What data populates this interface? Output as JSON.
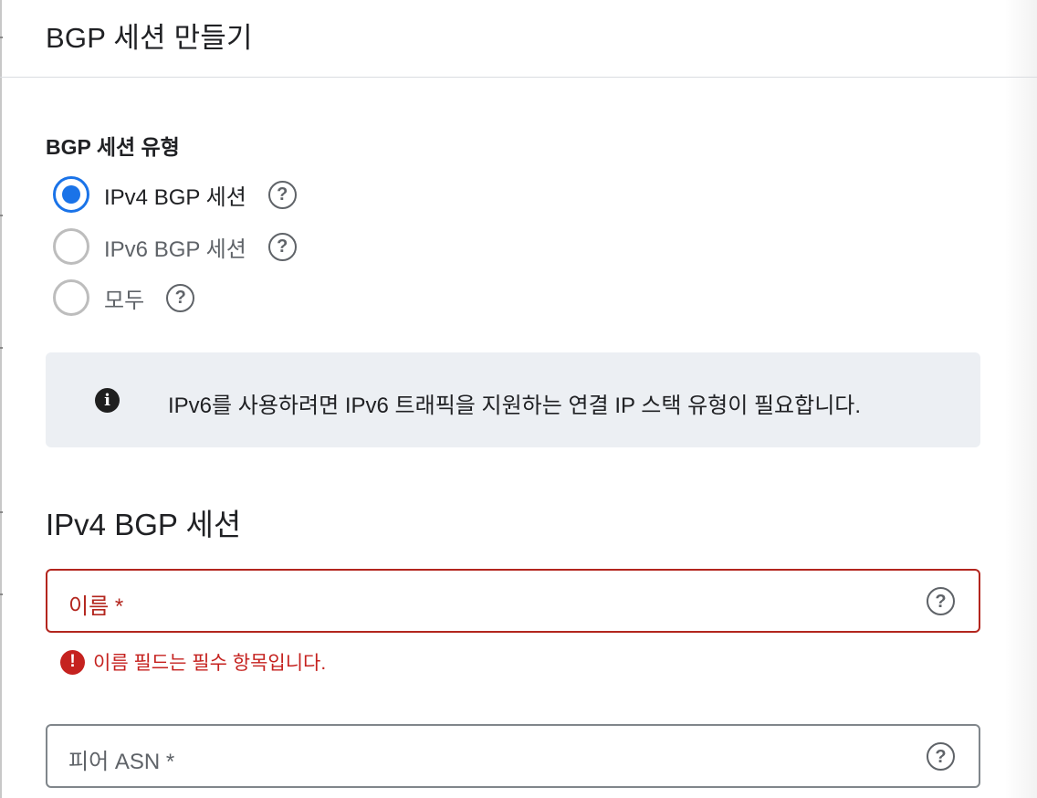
{
  "dialog": {
    "title": "BGP 세션 만들기"
  },
  "session_type": {
    "label": "BGP 세션 유형",
    "options": [
      {
        "label": "IPv4 BGP 세션",
        "checked": true
      },
      {
        "label": "IPv6 BGP 세션",
        "checked": false
      },
      {
        "label": "모두",
        "checked": false
      }
    ]
  },
  "info_banner": {
    "text": "IPv6를 사용하려면 IPv6 트래픽을 지원하는 연결 IP 스택 유형이 필요합니다."
  },
  "ipv4_section": {
    "title": "IPv4 BGP 세션",
    "name_field": {
      "placeholder": "이름 *",
      "error": "이름 필드는 필수 항목입니다."
    },
    "peer_asn_field": {
      "placeholder": "피어 ASN *"
    }
  },
  "icons": {
    "help": "?",
    "info": "i",
    "error": "!"
  },
  "colors": {
    "accent": "#1a73e8",
    "error": "#c5221f",
    "banner_bg": "#eceff3"
  }
}
